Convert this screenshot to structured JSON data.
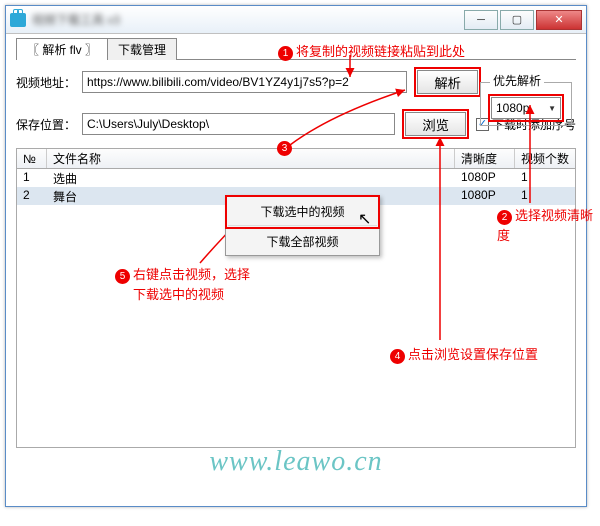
{
  "titlebar": {
    "title": "视频下载工具 v3"
  },
  "tabs": {
    "parse": "〖 解析  flv 〗",
    "manage": "下载管理"
  },
  "labels": {
    "url": "视频地址：",
    "save": "保存位置：",
    "priority": "优先解析"
  },
  "inputs": {
    "url": "https://www.bilibili.com/video/BV1YZ4y1j7s5?p=2",
    "save": "C:\\Users\\July\\Desktop\\"
  },
  "buttons": {
    "parse": "解析",
    "browse": "浏览"
  },
  "select": {
    "value": "1080p"
  },
  "checkbox": {
    "label": "下载时添加序号",
    "checked": "✓"
  },
  "table": {
    "headers": {
      "no": "№",
      "name": "文件名称",
      "res": "清晰度",
      "cnt": "视频个数"
    },
    "rows": [
      {
        "no": "1",
        "name": "选曲",
        "res": "1080P",
        "cnt": "1"
      },
      {
        "no": "2",
        "name": "舞台",
        "res": "1080P",
        "cnt": "1"
      }
    ]
  },
  "context_menu": {
    "dl_selected": "下载选中的视频",
    "dl_all": "下载全部视频"
  },
  "annotations": {
    "a1": "将复制的视频链接粘贴到此处",
    "a2": "选择视频清晰度",
    "a3": "",
    "a4": "点击浏览设置保存位置",
    "a5a": "右键点击视频，选择",
    "a5b": "下载选中的视频"
  },
  "watermark": "www.leawo.cn"
}
